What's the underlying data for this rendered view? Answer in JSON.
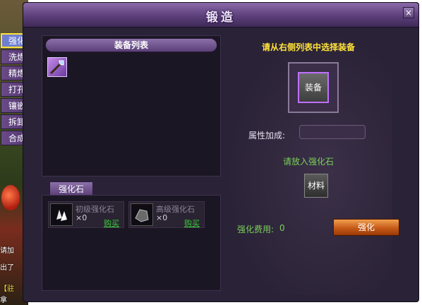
{
  "window": {
    "title": "锻造",
    "close_label": "×"
  },
  "tabs": [
    "强化",
    "洗炼",
    "精炼",
    "打孔",
    "镶嵌",
    "拆卸",
    "合成"
  ],
  "equipment_list": {
    "header": "装备列表"
  },
  "stones": {
    "tab_label": "强化石",
    "items": [
      {
        "name": "初级强化石",
        "count": "×0",
        "buy_label": "购买"
      },
      {
        "name": "高级强化石",
        "count": "×0",
        "buy_label": "购买"
      }
    ]
  },
  "detail": {
    "prompt": "请从右侧列表中选择装备",
    "equip_slot_label": "装备",
    "attr_label": "属性加成:",
    "stone_prompt": "请放入强化石",
    "material_label": "材料",
    "cost_label": "强化费用:",
    "cost_value": "0",
    "enhance_label": "强化"
  },
  "background_chat": [
    "请加",
    "出了",
    "【驻",
    "拿"
  ]
}
